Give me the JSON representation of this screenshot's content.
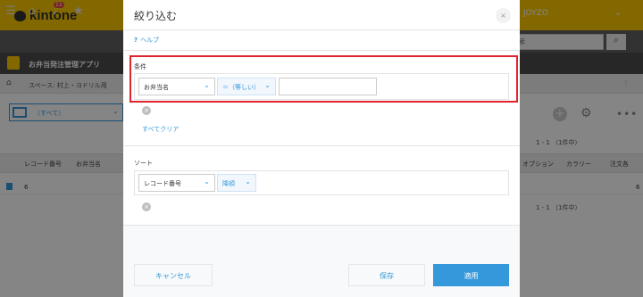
{
  "app": {
    "brand": "kintone",
    "user": "JOYZO",
    "notification_count": "11",
    "search_placeholder": "内検索",
    "app_name": "お弁当発注管理アプリ",
    "breadcrumb": "スペース: 村上・ヨドリル用",
    "view_name": "（すべて）",
    "page_count_top": "1 - 1 （1件中）",
    "page_count_bottom": "1 - 1 （1件中）",
    "columns_left": [
      "レコード番号",
      "お弁当名"
    ],
    "columns_right": [
      "オプション",
      "カラリー",
      "注文各"
    ],
    "rows": [
      {
        "record_no": "6",
        "edge": "6"
      }
    ]
  },
  "modal": {
    "title": "絞り込む",
    "close_symbol": "×",
    "help": "ヘルプ",
    "conditions_label": "条件",
    "condition": {
      "field": "お弁当名",
      "operator": "＝（等しい）",
      "value": ""
    },
    "clear_all": "すべてクリア",
    "sort_label": "ソート",
    "sort": {
      "field": "レコード番号",
      "order": "降順"
    },
    "cancel_button": "キャンセル",
    "save_button": "保存",
    "apply_button": "適用"
  },
  "colors": {
    "accent": "#3498db",
    "brand_yellow": "#fcc800",
    "highlight_red": "#e0242e"
  }
}
